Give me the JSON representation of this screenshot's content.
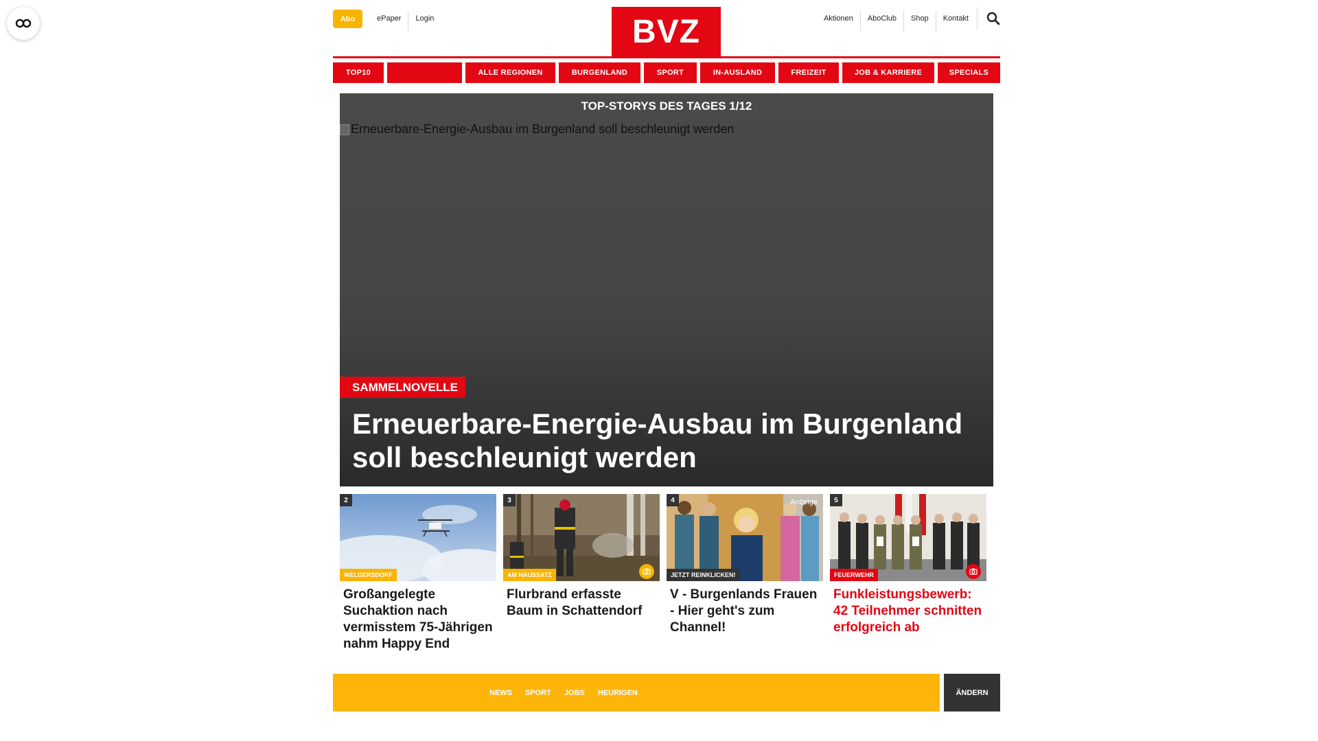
{
  "header": {
    "abo_label": "Abo",
    "left_links": [
      "ePaper",
      "Login"
    ],
    "logo_text": "BVZ",
    "right_links": [
      "Aktionen",
      "AboClub",
      "Shop",
      "Kontakt"
    ]
  },
  "nav": {
    "items": [
      "TOP10",
      "",
      "ALLE REGIONEN",
      "BURGENLAND",
      "SPORT",
      "IN-AUSLAND",
      "FREIZEIT",
      "JOB & KARRIERE",
      "SPECIALS"
    ]
  },
  "hero": {
    "heading": "TOP-STORYS DES TAGES 1/12",
    "image_alt": "Erneuerbare-Energie-Ausbau im Burgenland soll beschleunigt werden",
    "tag": "SAMMELNOVELLE",
    "title": "Erneuerbare-Energie-Ausbau im Burgenland soll beschleunigt werden"
  },
  "cards": [
    {
      "number": "2",
      "tag": "WELGERSDORF",
      "title": "Großangelegte Suchaktion nach vermisstem 75-Jährigen nahm Happy End"
    },
    {
      "number": "3",
      "tag": "AM HAUSSATZ",
      "title": "Flurbrand erfasste Baum in Schattendorf"
    },
    {
      "number": "4",
      "tag": "JETZT REINKLICKEN!",
      "ad_label": "Anzeige",
      "title": "V - Burgenlands Frauen - Hier geht's zum Channel!"
    },
    {
      "number": "5",
      "tag": "FEUERWEHR",
      "title": "Funkleistungsbewerb: 42 Teilnehmer schnitten erfolgreich ab"
    }
  ],
  "bottom_bar": {
    "links": [
      "NEWS",
      "SPORT",
      "JOBS",
      "HEURIGEN"
    ],
    "change_label": "ÄNDERN"
  },
  "colors": {
    "brand_red": "#e30613",
    "accent_yellow": "#f8b400"
  }
}
